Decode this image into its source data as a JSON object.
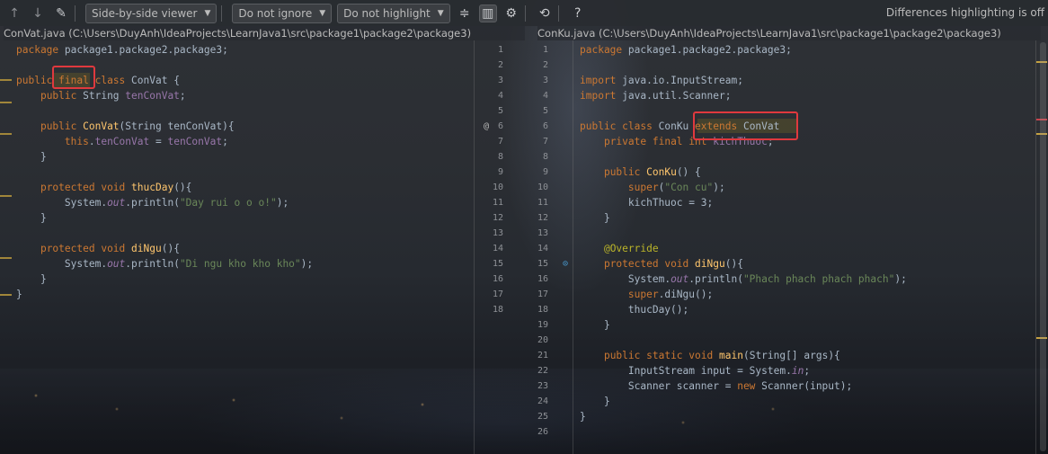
{
  "toolbar": {
    "viewer": "Side-by-side viewer",
    "whitespace": "Do not ignore",
    "highlight": "Do not highlight",
    "help": "?",
    "status": "Differences highlighting is off"
  },
  "left": {
    "header": "ConVat.java (C:\\Users\\DuyAnh\\IdeaProjects\\LearnJava1\\src\\package1\\package2\\package3)",
    "numbers": [
      "1",
      "2",
      "3",
      "4",
      "5",
      "6",
      "7",
      "8",
      "9",
      "10",
      "11",
      "12",
      "13",
      "14",
      "15",
      "16",
      "17",
      "18"
    ],
    "lines": [
      "package package1.package2.package3;",
      "",
      "public final class ConVat {",
      "    public String tenConVat;",
      "",
      "    public ConVat(String tenConVat){",
      "        this.tenConVat = tenConVat;",
      "    }",
      "",
      "    protected void thucDay(){",
      "        System.out.println(\"Day rui o o o!\");",
      "    }",
      "",
      "    protected void diNgu(){",
      "        System.out.println(\"Di ngu kho kho kho\");",
      "    }",
      "}",
      ""
    ]
  },
  "right": {
    "header": "ConKu.java (C:\\Users\\DuyAnh\\IdeaProjects\\LearnJava1\\src\\package1\\package2\\package3)",
    "numbers": [
      "1",
      "2",
      "3",
      "4",
      "5",
      "6",
      "7",
      "8",
      "9",
      "10",
      "11",
      "12",
      "13",
      "14",
      "15",
      "16",
      "17",
      "18",
      "19",
      "20",
      "21",
      "22",
      "23",
      "24",
      "25",
      "26"
    ],
    "lines": [
      "package package1.package2.package3;",
      "",
      "import java.io.InputStream;",
      "import java.util.Scanner;",
      "",
      "public class ConKu extends ConVat",
      "    private final int kichThuoc;",
      "",
      "    public ConKu() {",
      "        super(\"Con cu\");",
      "        kichThuoc = 3;",
      "    }",
      "",
      "    @Override",
      "    protected void diNgu(){",
      "        System.out.println(\"Phach phach phach phach\");",
      "        super.diNgu();",
      "        thucDay();",
      "    }",
      "",
      "    public static void main(String[] args){",
      "        InputStream input = System.in;",
      "        Scanner scanner = new Scanner(input);",
      "    }",
      "}",
      ""
    ]
  },
  "gutter": {
    "at_marker": "@"
  },
  "colors": {
    "keyword": "#cc7832",
    "field": "#9876aa",
    "method": "#ffc66d",
    "string": "#6a8759",
    "annotation": "#bbb529",
    "highlight_box": "#e0393e"
  }
}
